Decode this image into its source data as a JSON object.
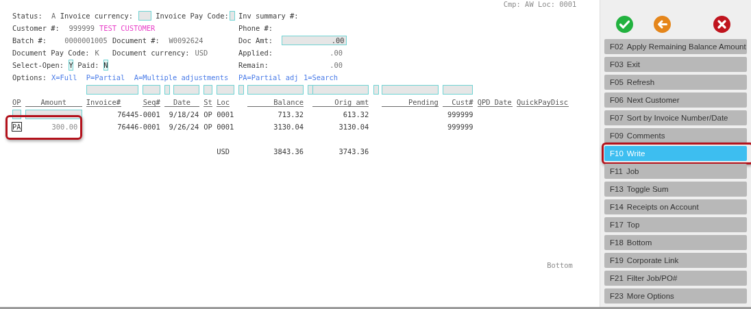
{
  "company_line": "Cmp: AW Loc: 0001",
  "form": {
    "status": {
      "label": "Status:",
      "value": "A"
    },
    "invoice_currency": {
      "label": "Invoice currency:"
    },
    "invoice_pay_code": {
      "label": "Invoice Pay Code:"
    },
    "inv_summary": {
      "label": "Inv summary #:"
    },
    "customer": {
      "label": "Customer #:",
      "value": "999999",
      "name": "TEST CUSTOMER"
    },
    "phone": {
      "label": "Phone #:"
    },
    "batch": {
      "label": "Batch #:",
      "value": "0000001005"
    },
    "document": {
      "label": "Document #:",
      "value": "W0092624"
    },
    "doc_amt": {
      "label": "Doc Amt:",
      "value": ".00"
    },
    "document_pay_code": {
      "label": "Document Pay Code:",
      "value": "K"
    },
    "document_currency": {
      "label": "Document currency:",
      "value": "USD"
    },
    "applied": {
      "label": "Applied:",
      "value": ".00"
    },
    "select_open": {
      "label": "Select-Open:",
      "value": "Y"
    },
    "paid": {
      "label": "Paid:",
      "value": "N"
    },
    "remain": {
      "label": "Remain:",
      "value": ".00"
    }
  },
  "options": {
    "label": "Options:",
    "items": [
      "X=Full",
      "P=Partial",
      "A=Multiple adjustments",
      "PA=Partial adj",
      "1=Search"
    ]
  },
  "table": {
    "columns": [
      "OP",
      "Amount",
      "Invoice#",
      "Seq#",
      "Date",
      "St",
      "Loc",
      "Balance",
      "Orig amt",
      "Pending",
      "Cust#",
      "QPD Date",
      "QuickPayDisc"
    ],
    "rows": [
      {
        "kind": "entry",
        "focused": false,
        "highlighted": false,
        "invoice": "76445-0001",
        "date": "9/18/24",
        "st": "OP",
        "loc": "0001",
        "balance": "713.32",
        "orig_amt": "613.32",
        "cust": "999999"
      },
      {
        "kind": "applied",
        "focused": true,
        "highlighted": true,
        "op": "PA",
        "amount": "300.00",
        "invoice": "76446-0001",
        "date": "9/26/24",
        "st": "OP",
        "loc": "0001",
        "balance": "3130.04",
        "orig_amt": "3130.04",
        "cust": "999999"
      }
    ],
    "total": {
      "currency": "USD",
      "balance": "3843.36",
      "orig_amt": "3743.36"
    }
  },
  "footer": "Bottom",
  "function_keys": [
    {
      "key": "F02",
      "label": "Apply Remaining Balance Amount",
      "selected": false,
      "highlighted": false
    },
    {
      "key": "F03",
      "label": "Exit",
      "selected": false,
      "highlighted": false
    },
    {
      "key": "F05",
      "label": "Refresh",
      "selected": false,
      "highlighted": false
    },
    {
      "key": "F06",
      "label": "Next Customer",
      "selected": false,
      "highlighted": false
    },
    {
      "key": "F07",
      "label": "Sort by Invoice Number/Date",
      "selected": false,
      "highlighted": false
    },
    {
      "key": "F09",
      "label": "Comments",
      "selected": false,
      "highlighted": false
    },
    {
      "key": "F10",
      "label": "Write",
      "selected": true,
      "highlighted": true
    },
    {
      "key": "F11",
      "label": "Job",
      "selected": false,
      "highlighted": false
    },
    {
      "key": "F13",
      "label": "Toggle Sum",
      "selected": false,
      "highlighted": false
    },
    {
      "key": "F14",
      "label": "Receipts on Account",
      "selected": false,
      "highlighted": false
    },
    {
      "key": "F17",
      "label": "Top",
      "selected": false,
      "highlighted": false
    },
    {
      "key": "F18",
      "label": "Bottom",
      "selected": false,
      "highlighted": false
    },
    {
      "key": "F19",
      "label": "Corporate Link",
      "selected": false,
      "highlighted": false
    },
    {
      "key": "F21",
      "label": "Filter Job/PO#",
      "selected": false,
      "highlighted": false
    },
    {
      "key": "F23",
      "label": "More Options",
      "selected": false,
      "highlighted": false
    }
  ]
}
